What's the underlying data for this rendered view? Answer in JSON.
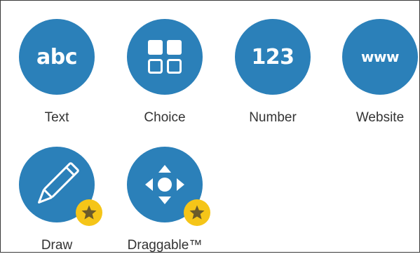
{
  "question_types": [
    {
      "label": "Text",
      "glyph": "abc",
      "icon": "abc-icon",
      "premium": false
    },
    {
      "label": "Choice",
      "glyph": "",
      "icon": "grid-icon",
      "premium": false
    },
    {
      "label": "Number",
      "glyph": "123",
      "icon": "number-icon",
      "premium": false
    },
    {
      "label": "Website",
      "glyph": "www",
      "icon": "www-icon",
      "premium": false
    },
    {
      "label": "Draw",
      "glyph": "",
      "icon": "pencil-icon",
      "premium": true
    },
    {
      "label": "Draggable™",
      "glyph": "",
      "icon": "move-arrows-icon",
      "premium": true
    }
  ],
  "colors": {
    "circle": "#2b80b9",
    "badge": "#f5c518",
    "star": "#6b5b2a",
    "label": "#333333",
    "border": "#3a3a3a"
  }
}
